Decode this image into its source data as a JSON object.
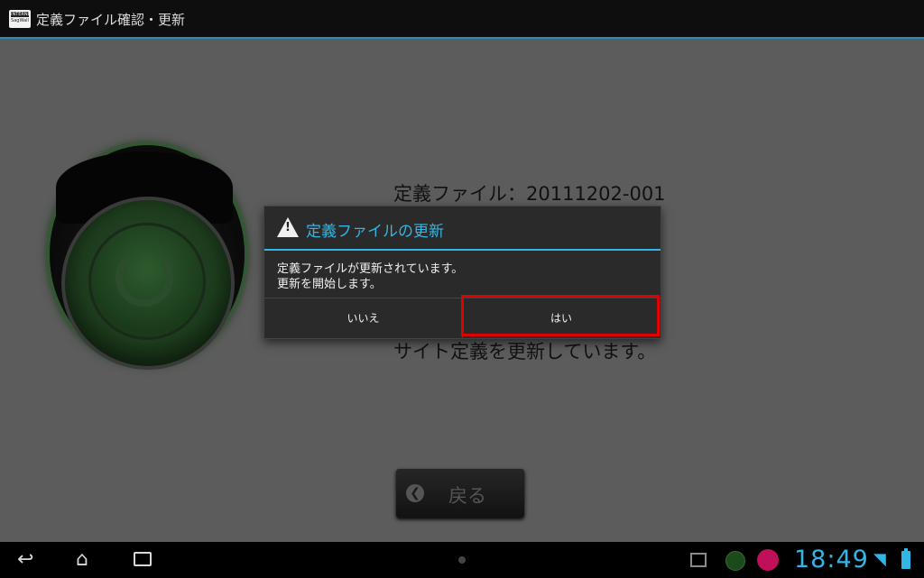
{
  "app": {
    "logo_top": "INTERNET",
    "logo_bottom": "SagWall",
    "title": "定義ファイル確認・更新"
  },
  "main": {
    "definition_file": "定義ファイル：20111202-001",
    "status": "サイト定義を更新しています。",
    "back_label": "戻る"
  },
  "dialog": {
    "title": "定義ファイルの更新",
    "message_line1": "定義ファイルが更新されています。",
    "message_line2": "更新を開始します。",
    "no_label": "いいえ",
    "yes_label": "はい"
  },
  "system_bar": {
    "clock": "18:49"
  },
  "colors": {
    "accent": "#33b5e5",
    "highlight": "#e00000"
  }
}
